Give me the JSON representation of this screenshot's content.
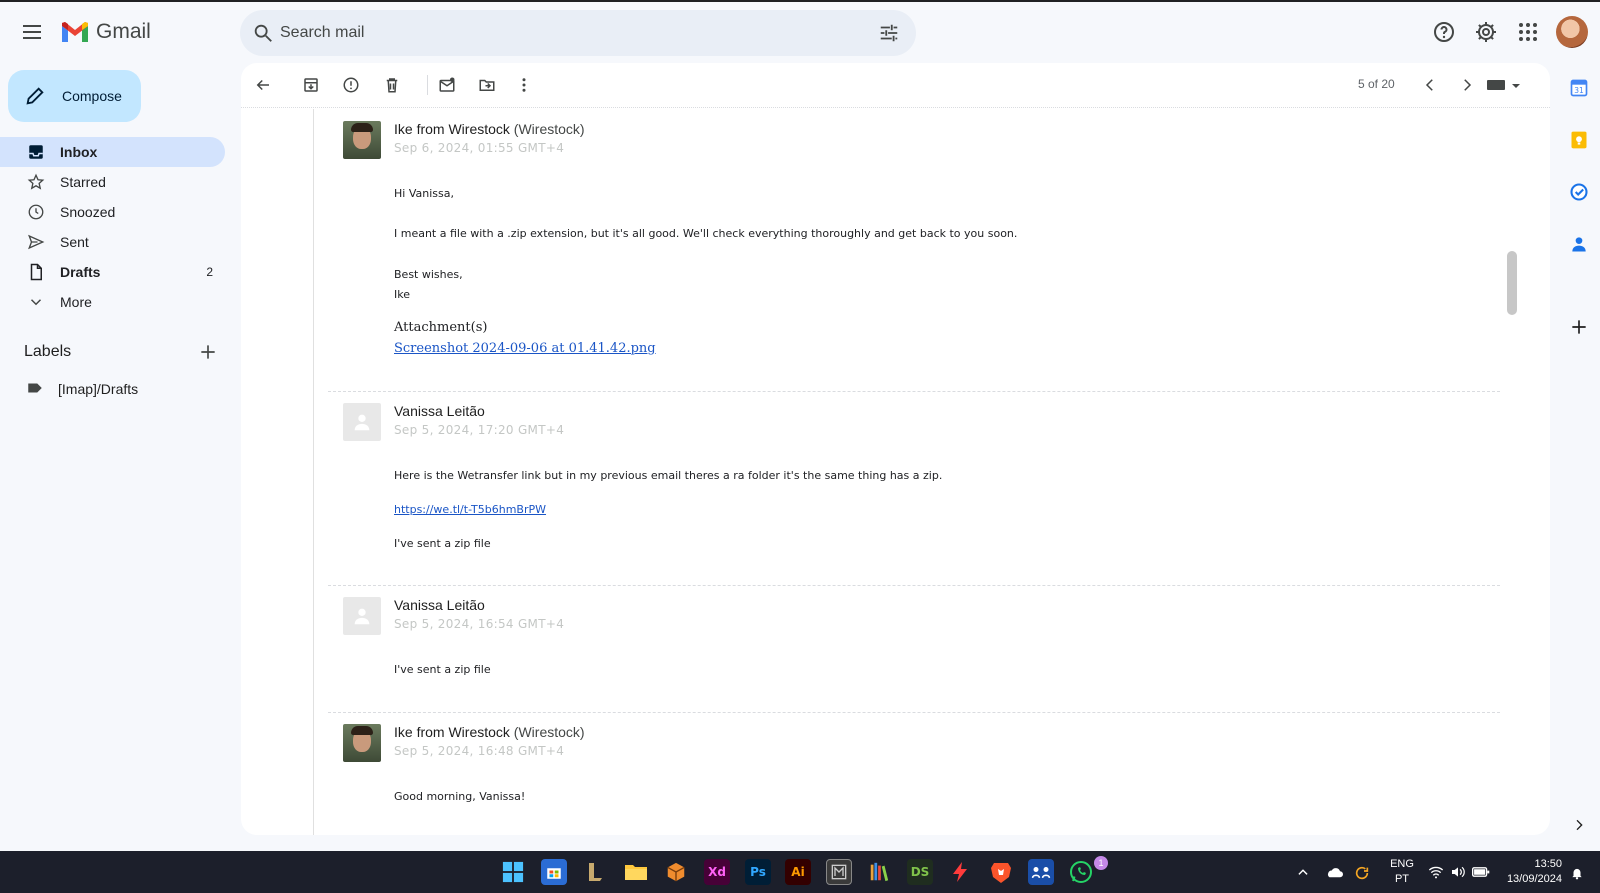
{
  "app": {
    "name": "Gmail"
  },
  "search": {
    "placeholder": "Search mail"
  },
  "compose": {
    "label": "Compose"
  },
  "nav": [
    {
      "label": "Inbox",
      "count": ""
    },
    {
      "label": "Starred",
      "count": ""
    },
    {
      "label": "Snoozed",
      "count": ""
    },
    {
      "label": "Sent",
      "count": ""
    },
    {
      "label": "Drafts",
      "count": "2"
    },
    {
      "label": "More",
      "count": ""
    }
  ],
  "labels": {
    "header": "Labels",
    "items": [
      "[Imap]/Drafts"
    ]
  },
  "toolbar": {
    "pager": "5 of 20"
  },
  "messages": [
    {
      "sender": "Ike from Wirestock",
      "org": "(Wirestock)",
      "date": "Sep 6, 2024, 01:55 GMT+4",
      "lines": [
        "Hi Vanissa,",
        "I meant a file with a .zip extension, but it's all good. We'll check everything thoroughly and get back to you soon.",
        "Best wishes,",
        "Ike"
      ],
      "attachment_title": "Attachment(s)",
      "attachment": "Screenshot 2024-09-06 at 01.41.42.png"
    },
    {
      "sender": "Vanissa Leitão",
      "date": "Sep 5, 2024, 17:20 GMT+4",
      "lines": [
        "Here is the Wetransfer link but in my previous email theres a ra folder it's the same thing has a zip.",
        "I've sent a zip file"
      ],
      "link": "https://we.tl/t-T5b6hmBrPW"
    },
    {
      "sender": "Vanissa Leitão",
      "date": "Sep 5, 2024, 16:54 GMT+4",
      "lines": [
        "I've sent a zip file"
      ]
    },
    {
      "sender": "Ike from Wirestock",
      "org": "(Wirestock)",
      "date": "Sep 5, 2024, 16:48 GMT+4",
      "lines": [
        "Good morning, Vanissa!"
      ]
    }
  ],
  "taskbar": {
    "apps": [
      "Xd",
      "Ps",
      "Ai",
      "DS"
    ],
    "whatsapp_badge": "1",
    "lang": [
      "ENG",
      "PT"
    ],
    "time": "13:50",
    "date": "13/09/2024"
  },
  "colors": {
    "accent": "#0b57d0",
    "compose": "#c2e7ff",
    "active_nav": "#d3e3fd",
    "link": "#1a55c6"
  }
}
